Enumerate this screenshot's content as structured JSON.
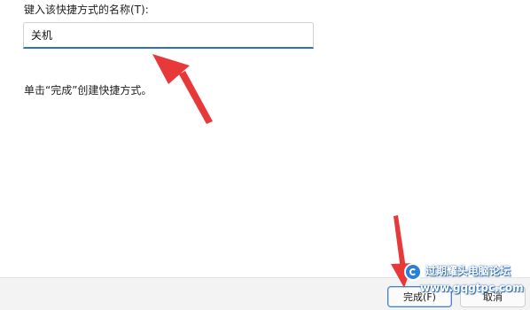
{
  "form": {
    "name_label": "键入该快捷方式的名称(T):",
    "name_value": "关机",
    "instruction": "单击“完成”创建快捷方式。"
  },
  "footer": {
    "finish_label": "完成(F)",
    "cancel_label": "取消"
  },
  "watermark": {
    "name": "过期耀头电脑论坛",
    "url": "www.gqgtpc.com"
  },
  "colors": {
    "accent": "#2f6fc9",
    "arrow": "#e8393a",
    "footer_bg": "#f3f3f3"
  }
}
